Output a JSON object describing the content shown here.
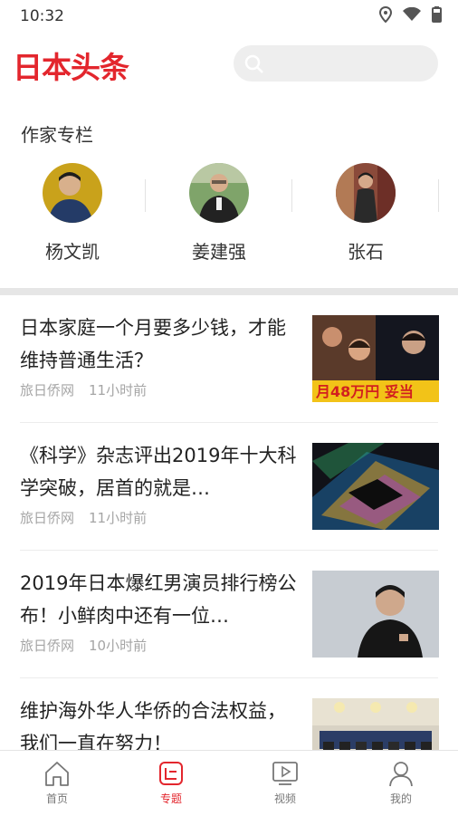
{
  "status_bar": {
    "time": "10:32"
  },
  "header": {
    "logo": "日本头条",
    "search_placeholder": ""
  },
  "authors_section": {
    "title": "作家专栏",
    "authors": [
      {
        "name": "杨文凯"
      },
      {
        "name": "姜建强"
      },
      {
        "name": "张石"
      }
    ]
  },
  "news": [
    {
      "title": "日本家庭一个月要多少钱，才能维持普通生活？",
      "source": "旅日侨网",
      "time": "11小时前",
      "thumb_text": "月48万円 妥当"
    },
    {
      "title": "《科学》杂志评出2019年十大科学突破，居首的就是…",
      "source": "旅日侨网",
      "time": "11小时前"
    },
    {
      "title": "2019年日本爆红男演员排行榜公布！小鲜肉中还有一位…",
      "source": "旅日侨网",
      "time": "10小时前"
    },
    {
      "title": "维护海外华人华侨的合法权益，我们一直在努力！",
      "source": "",
      "time": ""
    }
  ],
  "tabs": [
    {
      "label": "首页"
    },
    {
      "label": "专题"
    },
    {
      "label": "视频"
    },
    {
      "label": "我的"
    }
  ],
  "colors": {
    "brand": "#e3262d",
    "meta": "#a5a5a5"
  }
}
